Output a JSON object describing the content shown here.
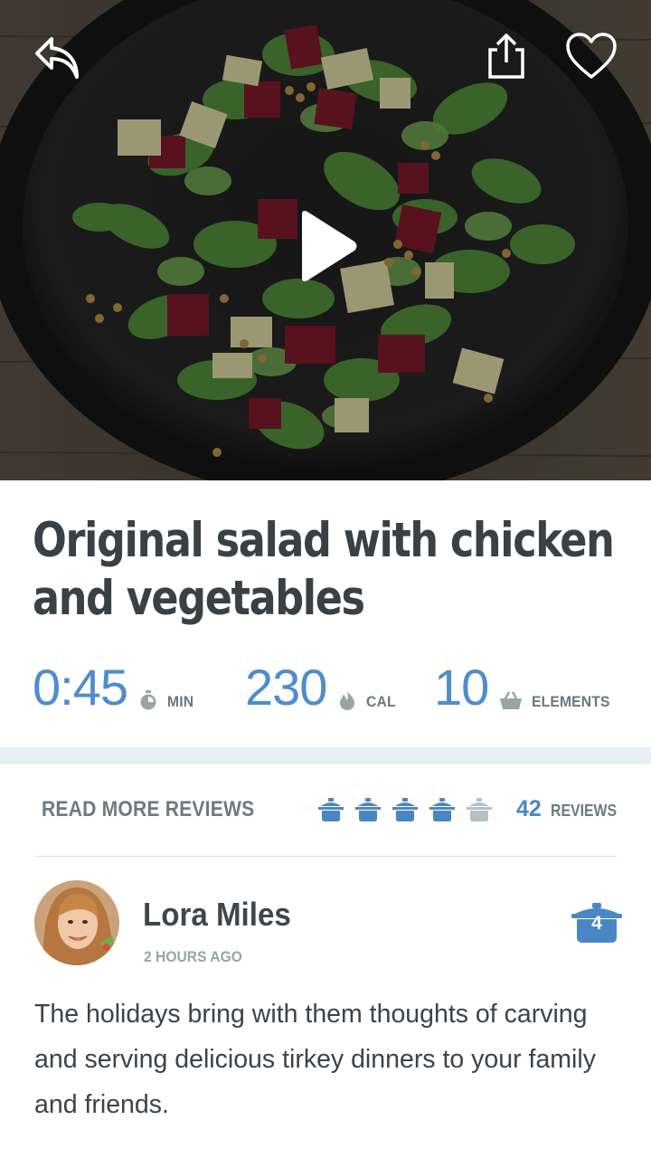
{
  "header": {
    "back_icon": "back-arrow-icon",
    "share_icon": "share-icon",
    "favorite_icon": "heart-icon",
    "play_icon": "play-icon"
  },
  "recipe": {
    "title": "Original salad with chicken and vegetables",
    "time": {
      "value": "0:45",
      "unit": "MIN",
      "icon": "timer-icon"
    },
    "calories": {
      "value": "230",
      "unit": "CAL",
      "icon": "flame-icon"
    },
    "elements": {
      "value": "10",
      "unit": "ELEMENTS",
      "icon": "basket-icon"
    }
  },
  "reviews": {
    "read_more_label": "READ MORE REVIEWS",
    "rating": {
      "filled": 4,
      "total": 5
    },
    "count": "42",
    "count_label": "REVIEWS",
    "item": {
      "name": "Lora Miles",
      "time": "2 HOURS AGO",
      "rating": "4",
      "text": "The holidays bring with them thoughts of carving and serving delicious tirkey dinners to your family and friends."
    }
  },
  "colors": {
    "accent": "#4f8ccb",
    "title": "#3a4045",
    "muted": "#6f7a80",
    "band": "#e6f0f5",
    "pot_filled": "#4a86c5",
    "pot_empty": "#b4c0c6"
  }
}
